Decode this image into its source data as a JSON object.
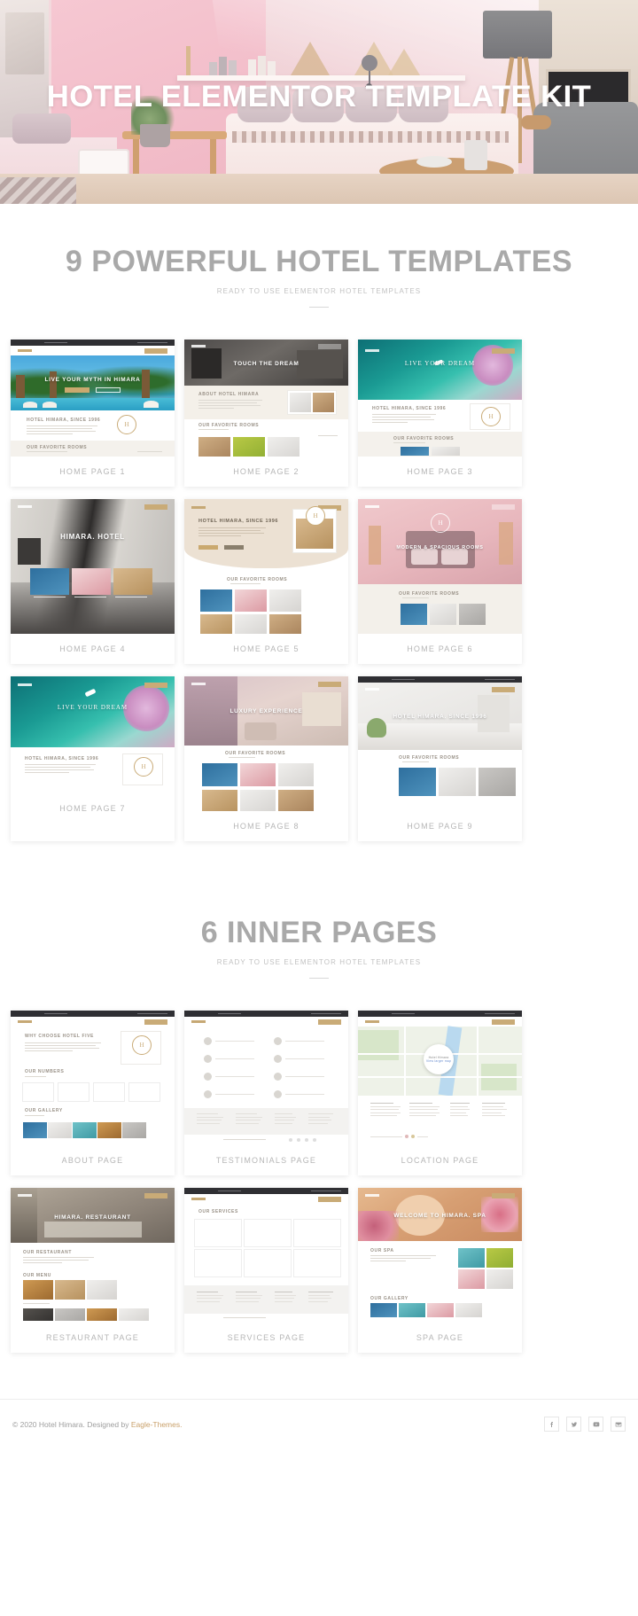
{
  "hero": {
    "title": "HOTEL ELEMENTOR TEMPLATE KIT"
  },
  "sections": [
    {
      "id": "templates",
      "title": "9 POWERFUL HOTEL TEMPLATES",
      "subtitle": "READY TO USE ELEMENTOR HOTEL TEMPLATES",
      "cards": [
        {
          "caption": "HOME PAGE 1",
          "hero_text": "LIVE YOUR MYTH IN HIMARA",
          "band_title": "HOTEL HIMARA, SINCE 1996",
          "band_title2": "OUR FAVORITE ROOMS"
        },
        {
          "caption": "HOME PAGE 2",
          "hero_text": "TOUCH THE DREAM",
          "band_title": "ABOUT HOTEL HIMARA",
          "band_title2": "OUR FAVORITE ROOMS"
        },
        {
          "caption": "HOME PAGE 3",
          "hero_text": "LIVE YOUR DREAM",
          "band_title": "HOTEL HIMARA, SINCE 1996",
          "band_title2": "OUR FAVORITE ROOMS"
        },
        {
          "caption": "HOME PAGE 4",
          "hero_text": "HIMARA. HOTEL",
          "band_title": "",
          "band_title2": ""
        },
        {
          "caption": "HOME PAGE 5",
          "hero_text": "HOTEL HIMARA, SINCE 1996",
          "band_title": "OUR FAVORITE ROOMS",
          "band_title2": ""
        },
        {
          "caption": "HOME PAGE 6",
          "hero_text": "MODERN & SPACIOUS ROOMS",
          "band_title": "OUR FAVORITE ROOMS",
          "band_title2": ""
        },
        {
          "caption": "HOME PAGE 7",
          "hero_text": "LIVE YOUR DREAM",
          "band_title": "HOTEL HIMARA, SINCE 1996",
          "band_title2": ""
        },
        {
          "caption": "HOME PAGE 8",
          "hero_text": "LUXURY EXPERIENCE",
          "band_title": "OUR FAVORITE ROOMS",
          "band_title2": ""
        },
        {
          "caption": "HOME PAGE 9",
          "hero_text": "HOTEL HIMARA. SINCE 1996",
          "band_title": "OUR FAVORITE ROOMS",
          "band_title2": ""
        }
      ]
    },
    {
      "id": "inner",
      "title": "6 INNER PAGES",
      "subtitle": "READY TO USE ELEMENTOR HOTEL TEMPLATES",
      "cards": [
        {
          "caption": "ABOUT PAGE",
          "hero_text": "",
          "band_title": "WHY CHOOSE HOTEL FIVE",
          "band_title2": "OUR GALLERY"
        },
        {
          "caption": "TESTIMONIALS PAGE",
          "hero_text": "",
          "band_title": "",
          "band_title2": ""
        },
        {
          "caption": "LOCATION PAGE",
          "hero_text": "",
          "band_title": "",
          "band_title2": "",
          "map_label": "Hotel Himara",
          "map_sub": "View larger map"
        },
        {
          "caption": "RESTAURANT PAGE",
          "hero_text": "HIMARA. RESTAURANT",
          "band_title": "OUR RESTAURANT",
          "band_title2": "OUR MENU"
        },
        {
          "caption": "SERVICES PAGE",
          "hero_text": "OUR SERVICES",
          "band_title": "",
          "band_title2": ""
        },
        {
          "caption": "SPA PAGE",
          "hero_text": "WELCOME TO HIMARA. SPA",
          "band_title": "OUR SPA",
          "band_title2": "OUR GALLERY"
        }
      ]
    }
  ],
  "footer": {
    "copyright_prefix": "© 2020 Hotel Himara. Designed by ",
    "credit_link": "Eagle-Themes.",
    "socials": [
      {
        "name": "facebook",
        "glyph": "f"
      },
      {
        "name": "twitter",
        "glyph": "t"
      },
      {
        "name": "youtube",
        "glyph": "y"
      },
      {
        "name": "email",
        "glyph": "e"
      }
    ]
  },
  "colors": {
    "accent": "#c9ab77",
    "heading": "#a9a9a9",
    "caption": "#b6b6b6",
    "link": "#c9a06a"
  }
}
